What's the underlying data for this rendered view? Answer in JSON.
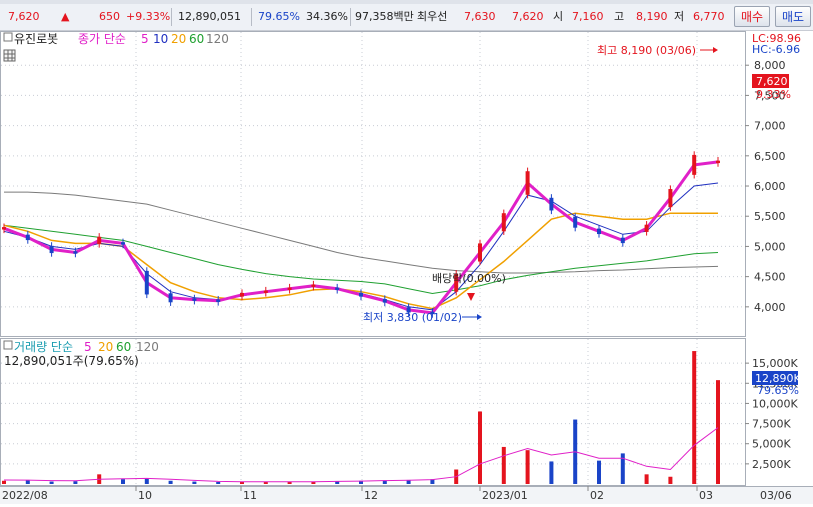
{
  "top_bar": {
    "current_price": "7,620",
    "change_arrow": "▲",
    "change_amount": "650",
    "change_pct": "+9.33%",
    "volume": "12,890,051",
    "volume_ratio": "79.65%",
    "turnover_rate": "34.36%",
    "trade_value": "97,358백만",
    "ask_label": "최우선",
    "best_ask": "7,630",
    "best_bid": "7,620",
    "open_label": "시",
    "open": "7,160",
    "high_label": "고",
    "high": "8,190",
    "low_label": "저",
    "low": "6,770",
    "buy_button": "매수",
    "sell_button": "매도"
  },
  "price_pane": {
    "stock_name": "유진로봇",
    "ma_title": "종가 단순",
    "ma_periods": [
      "5",
      "10",
      "20",
      "60",
      "120"
    ],
    "upper_limit_label": "LC:98.96",
    "lower_limit_label": "HC:-6.96",
    "current_price_tag": "7,620",
    "current_pct_tag": "9.33%",
    "high_annotation": "최고 8,190 (03/06)",
    "low_annotation": "최저 3,830 (01/02)",
    "dividend_annotation": "배당락(0.00%)",
    "y_ticks": [
      "8,000",
      "7,500",
      "7,000",
      "6,500",
      "6,000",
      "5,500",
      "5,000",
      "4,500",
      "4,000"
    ]
  },
  "volume_pane": {
    "title": "거래량 단순",
    "ma_periods": [
      "5",
      "20",
      "60",
      "120"
    ],
    "current_volume": "12,890,051주(79.65%)",
    "current_volume_tag": "12,890K",
    "current_ratio_tag": "79.65%",
    "y_ticks": [
      "15,000K",
      "12,500K",
      "10,000K",
      "7,500K",
      "5,000K",
      "2,500K"
    ]
  },
  "x_axis": {
    "labels": [
      "2022/08",
      "10",
      "11",
      "12",
      "2023/01",
      "02",
      "03",
      "03/06"
    ]
  },
  "colors": {
    "up": "#e4141e",
    "down": "#1a44c8",
    "ma5": "#e020c8",
    "ma10": "#2030c0",
    "ma20": "#f0a000",
    "ma60": "#1fa030",
    "ma120": "#7a7a7a",
    "grid": "#c8ccd4"
  },
  "chart_data": [
    {
      "type": "line",
      "title": "유진로봇",
      "xlabel": "",
      "ylabel": "",
      "note": "price pane with daily candles and moving averages",
      "ylim": [
        3600,
        8500
      ],
      "x": [
        "2022/08",
        "08",
        "08",
        "08",
        "08",
        "09",
        "09",
        "09",
        "09",
        "10",
        "10",
        "10",
        "10",
        "11",
        "11",
        "11",
        "11",
        "12",
        "12",
        "12",
        "12",
        "2023/01",
        "01",
        "01",
        "01",
        "02",
        "02",
        "02",
        "02",
        "03",
        "03/06"
      ],
      "series": [
        {
          "name": "5",
          "values": [
            5300,
            5150,
            4950,
            4900,
            5100,
            5050,
            4400,
            4150,
            4120,
            4100,
            4200,
            4250,
            4300,
            4350,
            4300,
            4200,
            4100,
            3950,
            3900,
            4400,
            4900,
            5400,
            6050,
            5700,
            5400,
            5250,
            5100,
            5300,
            5800,
            6350,
            6400
          ]
        },
        {
          "name": "10",
          "values": [
            5250,
            5150,
            5000,
            4950,
            5050,
            5000,
            4550,
            4250,
            4150,
            4120,
            4180,
            4250,
            4300,
            4330,
            4300,
            4220,
            4120,
            4000,
            3950,
            4250,
            4700,
            5250,
            5850,
            5750,
            5500,
            5350,
            5200,
            5250,
            5650,
            6000,
            6050
          ]
        },
        {
          "name": "20",
          "values": [
            5350,
            5250,
            5100,
            5050,
            5050,
            5000,
            4700,
            4400,
            4250,
            4150,
            4120,
            4150,
            4200,
            4280,
            4300,
            4250,
            4170,
            4050,
            3970,
            4150,
            4450,
            4750,
            5100,
            5450,
            5550,
            5500,
            5450,
            5450,
            5550,
            5550,
            5550
          ]
        },
        {
          "name": "60",
          "values": [
            5350,
            5300,
            5250,
            5200,
            5150,
            5100,
            5000,
            4900,
            4800,
            4700,
            4620,
            4550,
            4500,
            4460,
            4440,
            4420,
            4380,
            4300,
            4220,
            4280,
            4350,
            4450,
            4520,
            4580,
            4640,
            4680,
            4720,
            4760,
            4820,
            4880,
            4900
          ]
        },
        {
          "name": "120",
          "values": [
            5900,
            5900,
            5880,
            5850,
            5800,
            5750,
            5700,
            5600,
            5500,
            5400,
            5300,
            5200,
            5100,
            5000,
            4900,
            4820,
            4760,
            4700,
            4640,
            4600,
            4580,
            4560,
            4560,
            4570,
            4580,
            4600,
            4610,
            4630,
            4650,
            4660,
            4670
          ]
        }
      ]
    },
    {
      "type": "bar",
      "title": "거래량 단순",
      "xlabel": "",
      "ylabel": "",
      "note": "volume in thousands of shares",
      "ylim": [
        0,
        17500
      ],
      "x": [
        "2022/08",
        "08",
        "08",
        "08",
        "08",
        "09",
        "09",
        "09",
        "09",
        "10",
        "10",
        "10",
        "10",
        "11",
        "11",
        "11",
        "11",
        "12",
        "12",
        "12",
        "12",
        "2023/01",
        "01",
        "01",
        "01",
        "02",
        "02",
        "02",
        "02",
        "03",
        "03/06"
      ],
      "series": [
        {
          "name": "거래량",
          "values": [
            400,
            500,
            300,
            350,
            1200,
            600,
            700,
            400,
            300,
            250,
            300,
            280,
            260,
            300,
            350,
            400,
            450,
            500,
            600,
            1800,
            9000,
            4600,
            4200,
            2800,
            8000,
            2900,
            3800,
            1200,
            900,
            16500,
            12890
          ]
        },
        {
          "name": "5",
          "values": [
            500,
            480,
            420,
            400,
            600,
            650,
            700,
            600,
            450,
            320,
            290,
            280,
            270,
            280,
            320,
            360,
            420,
            470,
            540,
            900,
            2500,
            3500,
            4400,
            3600,
            4000,
            3200,
            3200,
            2200,
            1800,
            4800,
            7000
          ]
        }
      ]
    }
  ]
}
